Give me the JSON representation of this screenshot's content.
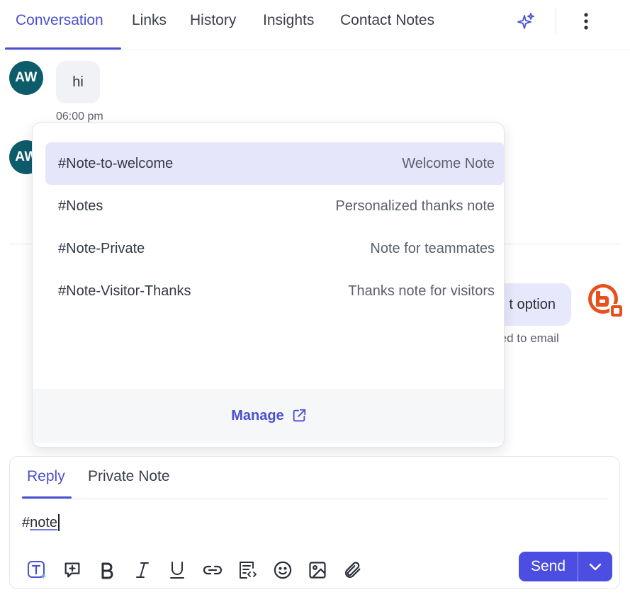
{
  "tabs": [
    {
      "label": "Conversation",
      "active": true
    },
    {
      "label": "Links"
    },
    {
      "label": "History"
    },
    {
      "label": "Insights"
    },
    {
      "label": "Contact Notes"
    }
  ],
  "header": {
    "ai_icon": "sparkles-icon",
    "more_icon": "more-vertical-icon"
  },
  "conversation": {
    "messages": [
      {
        "avatar_initials": "AW",
        "text": "hi",
        "time": "06:00 pm"
      },
      {
        "avatar_initials": "AW"
      }
    ],
    "outgoing": {
      "text": "t option",
      "subtext": "red to email",
      "avatar_icon": "brand-logo-icon"
    }
  },
  "dropdown": {
    "items": [
      {
        "key": "#Note-to-welcome",
        "desc": "Welcome Note",
        "selected": true
      },
      {
        "key": "#Notes",
        "desc": "Personalized thanks note"
      },
      {
        "key": "#Note-Private",
        "desc": "Note for teammates"
      },
      {
        "key": "#Note-Visitor-Thanks",
        "desc": "Thanks note for visitors"
      }
    ],
    "manage_label": "Manage",
    "manage_icon": "external-link-icon"
  },
  "composer": {
    "tabs": [
      {
        "label": "Reply",
        "active": true
      },
      {
        "label": "Private Note"
      }
    ],
    "editor": {
      "prefix": "#",
      "typed": "note"
    },
    "toolbar_icons": [
      "text-ai-icon",
      "add-comment-icon",
      "bold-icon",
      "italic-icon",
      "underline-icon",
      "link-icon",
      "snippet-icon",
      "emoji-icon",
      "image-icon",
      "attachment-icon"
    ],
    "send_label": "Send"
  },
  "colors": {
    "accent": "#4b4fd0",
    "send": "#4b4ee0",
    "avatar": "#0d5c6b",
    "selected_row": "#e5e6fa",
    "brand": "#e8501b"
  }
}
